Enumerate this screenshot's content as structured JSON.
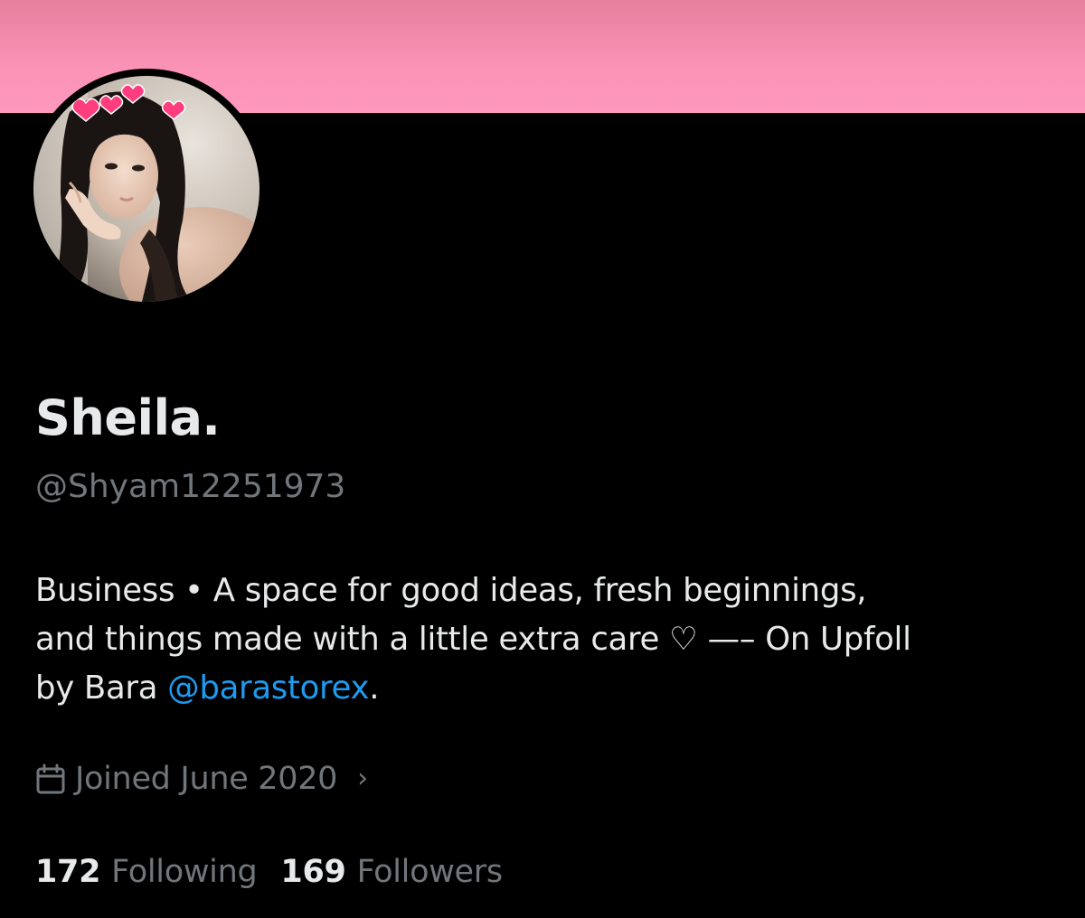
{
  "profile": {
    "display_name": "Sheila.",
    "handle": "@Shyam12251973",
    "bio": {
      "line1": "Business • A space for good ideas, fresh beginnings,",
      "line2_prefix": "and things made with a little extra care ",
      "heart": "♡",
      "line2_suffix": " —– On Upfoll",
      "line3_prefix": "by Bara ",
      "mention": "@barastorex",
      "line3_suffix": "."
    },
    "joined": "Joined June 2020",
    "joined_chevron": "›",
    "following_count": "172",
    "following_label": "Following",
    "followers_count": "169",
    "followers_label": "Followers"
  },
  "icons": {
    "calendar": "calendar-icon",
    "chevron": "chevron-right-icon"
  },
  "colors": {
    "background": "#000000",
    "banner": "#fb93b7",
    "primary_text": "#e7e9ea",
    "secondary_text": "#71767b",
    "link": "#1d9bf0"
  }
}
